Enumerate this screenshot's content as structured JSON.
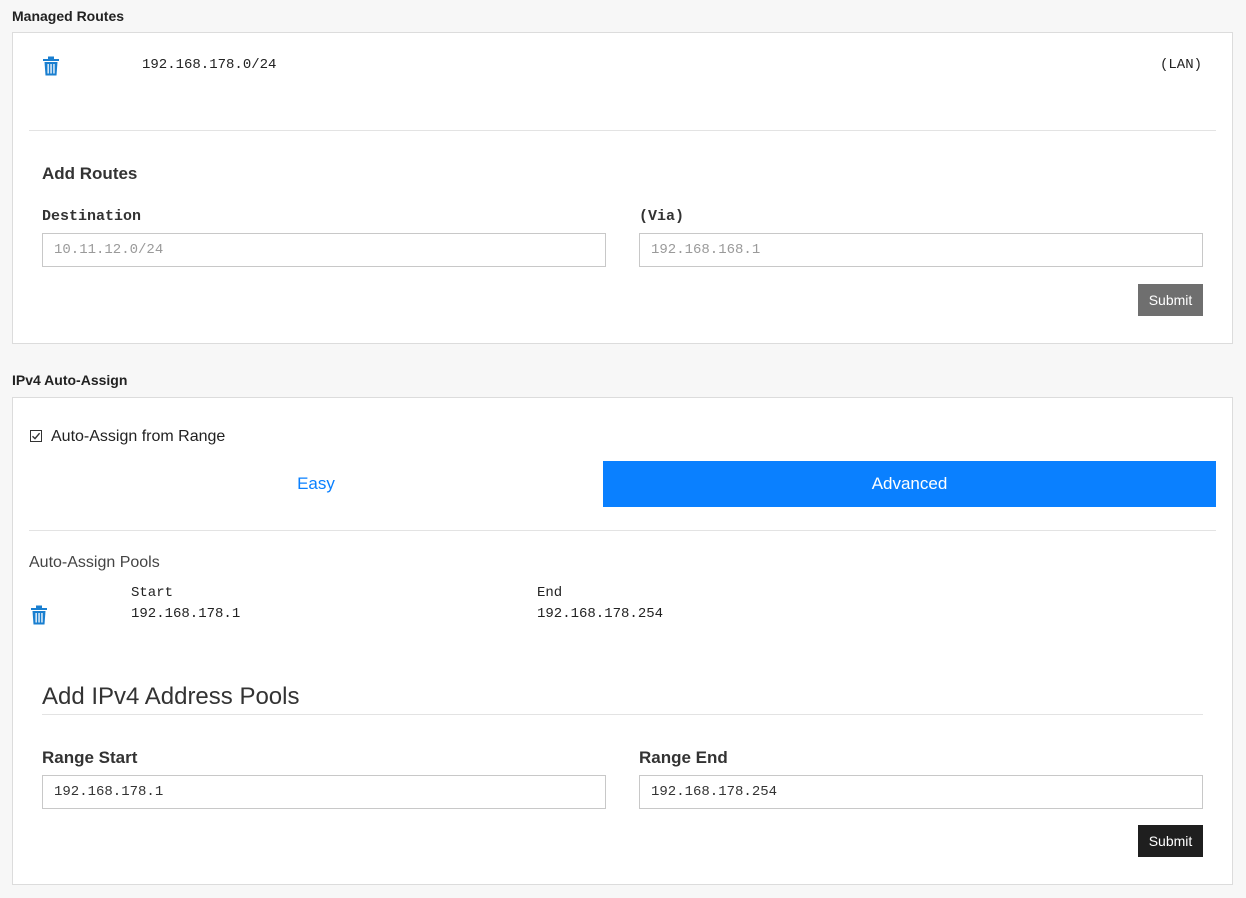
{
  "managed_routes": {
    "section_title": "Managed Routes",
    "routes": [
      {
        "destination": "192.168.178.0/24",
        "via": "(LAN)"
      }
    ],
    "add": {
      "heading": "Add Routes",
      "destination_label": "Destination",
      "destination_placeholder": "10.11.12.0/24",
      "via_label": "(Via)",
      "via_placeholder": "192.168.168.1",
      "submit_label": "Submit"
    }
  },
  "ipv4_auto_assign": {
    "section_title": "IPv4 Auto-Assign",
    "checkbox_label": "Auto-Assign from Range",
    "checkbox_checked": true,
    "tabs": {
      "easy": "Easy",
      "advanced": "Advanced",
      "active": "advanced"
    },
    "pools_heading": "Auto-Assign Pools",
    "pools_columns": {
      "start": "Start",
      "end": "End"
    },
    "pools": [
      {
        "start": "192.168.178.1",
        "end": "192.168.178.254"
      }
    ],
    "add": {
      "heading": "Add IPv4 Address Pools",
      "range_start_label": "Range Start",
      "range_start_value": "192.168.178.1",
      "range_end_label": "Range End",
      "range_end_value": "192.168.178.254",
      "submit_label": "Submit"
    }
  },
  "colors": {
    "accent": "#0a80ff",
    "trash_icon": "#1a7fd0",
    "submit_routes": "#6f6f6f",
    "submit_pools": "#1f1f1f"
  }
}
